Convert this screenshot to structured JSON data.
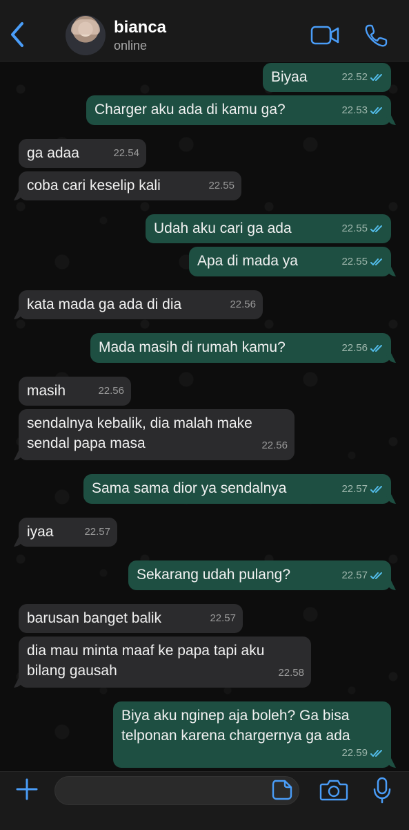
{
  "header": {
    "contact_name": "bianca",
    "status": "online"
  },
  "messages": [
    {
      "direction": "out",
      "text": "Biyaa",
      "time": "22.52"
    },
    {
      "direction": "out",
      "text": "Charger aku ada di kamu ga?",
      "time": "22.53"
    },
    {
      "direction": "in",
      "text": "ga adaa",
      "time": "22.54"
    },
    {
      "direction": "in",
      "text": "coba cari keselip kali",
      "time": "22.55"
    },
    {
      "direction": "out",
      "text": "Udah aku cari ga ada",
      "time": "22.55"
    },
    {
      "direction": "out",
      "text": "Apa di mada ya",
      "time": "22.55"
    },
    {
      "direction": "in",
      "text": "kata mada ga ada di dia",
      "time": "22.56"
    },
    {
      "direction": "out",
      "text": "Mada masih di rumah kamu?",
      "time": "22.56"
    },
    {
      "direction": "in",
      "text": "masih",
      "time": "22.56"
    },
    {
      "direction": "in",
      "text": "sendalnya kebalik, dia malah make\nsendal papa masa",
      "time": "22.56"
    },
    {
      "direction": "out",
      "text": "Sama sama dior ya sendalnya",
      "time": "22.57"
    },
    {
      "direction": "in",
      "text": "iyaa",
      "time": "22.57"
    },
    {
      "direction": "out",
      "text": "Sekarang udah pulang?",
      "time": "22.57"
    },
    {
      "direction": "in",
      "text": "barusan banget balik",
      "time": "22.57"
    },
    {
      "direction": "in",
      "text": "dia mau minta maaf ke papa tapi aku\nbilang gausah",
      "time": "22.58"
    },
    {
      "direction": "out",
      "text": "Biya aku nginep aja boleh? Ga bisa\ntelponan karena chargernya ga ada",
      "time": "22.59"
    }
  ],
  "composer": {
    "value": "",
    "placeholder": ""
  },
  "icons": {
    "back": "back-chevron-icon",
    "video": "video-call-icon",
    "phone": "voice-call-icon",
    "plus": "plus-icon",
    "sticker": "sticker-icon",
    "camera": "camera-icon",
    "mic": "microphone-icon"
  },
  "colors": {
    "accent": "#4a9df8",
    "incoming_bubble": "#2b2b2d",
    "outgoing_bubble": "#1e4f42",
    "read_ticks": "#53bdeb"
  }
}
